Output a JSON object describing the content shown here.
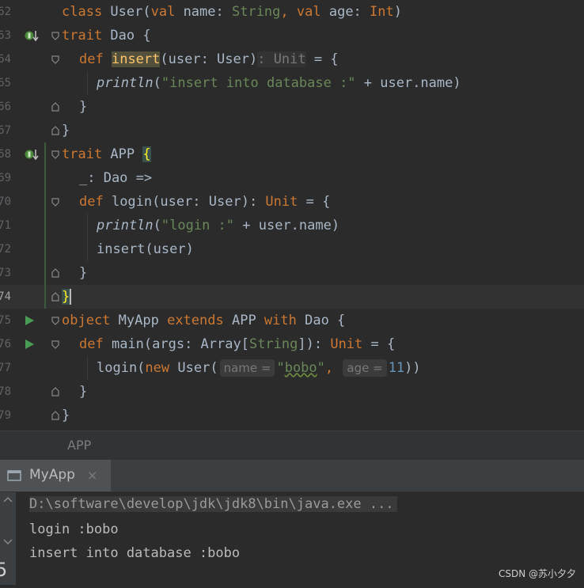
{
  "editor": {
    "lines": [
      {
        "num": "62"
      },
      {
        "num": "63"
      },
      {
        "num": "64"
      },
      {
        "num": "65"
      },
      {
        "num": "66"
      },
      {
        "num": "67"
      },
      {
        "num": "68"
      },
      {
        "num": "69"
      },
      {
        "num": "70"
      },
      {
        "num": "71"
      },
      {
        "num": "72"
      },
      {
        "num": "73"
      },
      {
        "num": "74"
      },
      {
        "num": "75"
      },
      {
        "num": "76"
      },
      {
        "num": "77"
      },
      {
        "num": "78"
      },
      {
        "num": "79"
      }
    ],
    "tokens": {
      "class_kw": "class",
      "User_cls": " User(",
      "val1": "val",
      "name_param": " name: ",
      "String1": "String",
      "comma_val": ", ",
      "val2": "val",
      "age_param": " age: ",
      "Int1": "Int",
      "close_paren": ")",
      "trait1": "trait",
      "Dao1": " Dao {",
      "def1": "def",
      "insert_fn": "insert",
      "insert_sig": "(user: User)",
      "unit_hint": ": Unit",
      "eq_brace1": " = {",
      "println1": "println",
      "str1_open": "(",
      "str1": "\"insert into database :\"",
      "plus1": " + user.name)",
      "rbrace1": "}",
      "rbrace2": "}",
      "trait2": "trait",
      "APP1": " APP ",
      "lbrace_hl": "{",
      "self_type": "_: Dao =>",
      "def2": "def",
      "login_fn": " login(user: User): ",
      "Unit2": "Unit",
      "eq_brace2": " = {",
      "println2": "println",
      "str2_open": "(",
      "str2": "\"login :\"",
      "plus2": " + user.name)",
      "insert_call": "insert(user)",
      "rbrace3": "}",
      "rbrace4": "}",
      "object_kw": "object",
      "MyApp1": " MyApp ",
      "extends_kw": "extends",
      "APP2": " APP ",
      "with_kw": "with",
      "Dao2": " Dao {",
      "def3": "def",
      "main_fn": " main(args: Array[",
      "String3": "String",
      "main_close": "]): ",
      "Unit3": "Unit",
      "eq_brace3": " = {",
      "login_call": "login(",
      "new_kw": "new",
      "User_ctor": " User(",
      "hint_name": "name =",
      "bobo_q1": "\"",
      "bobo": "bobo",
      "bobo_q2": "\"",
      "comma2": ",",
      "hint_age": "age =",
      "num11": "11",
      "close2": "))",
      "rbrace5": "}",
      "rbrace6": "}"
    }
  },
  "breadcrumb": {
    "label": "APP"
  },
  "run_panel": {
    "tab_title": "MyApp",
    "close_glyph": "×",
    "console_lines": [
      "D:\\software\\develop\\jdk\\jdk8\\bin\\java.exe ...",
      "login :bobo",
      "insert into database :bobo"
    ],
    "side_digit": "5"
  },
  "watermark": {
    "text": "CSDN @苏小夕夕"
  },
  "colors": {
    "keyword": "#cc7832",
    "string": "#6a8759",
    "number": "#6897bb",
    "text": "#a9b7c6",
    "background": "#2b2b2b"
  }
}
